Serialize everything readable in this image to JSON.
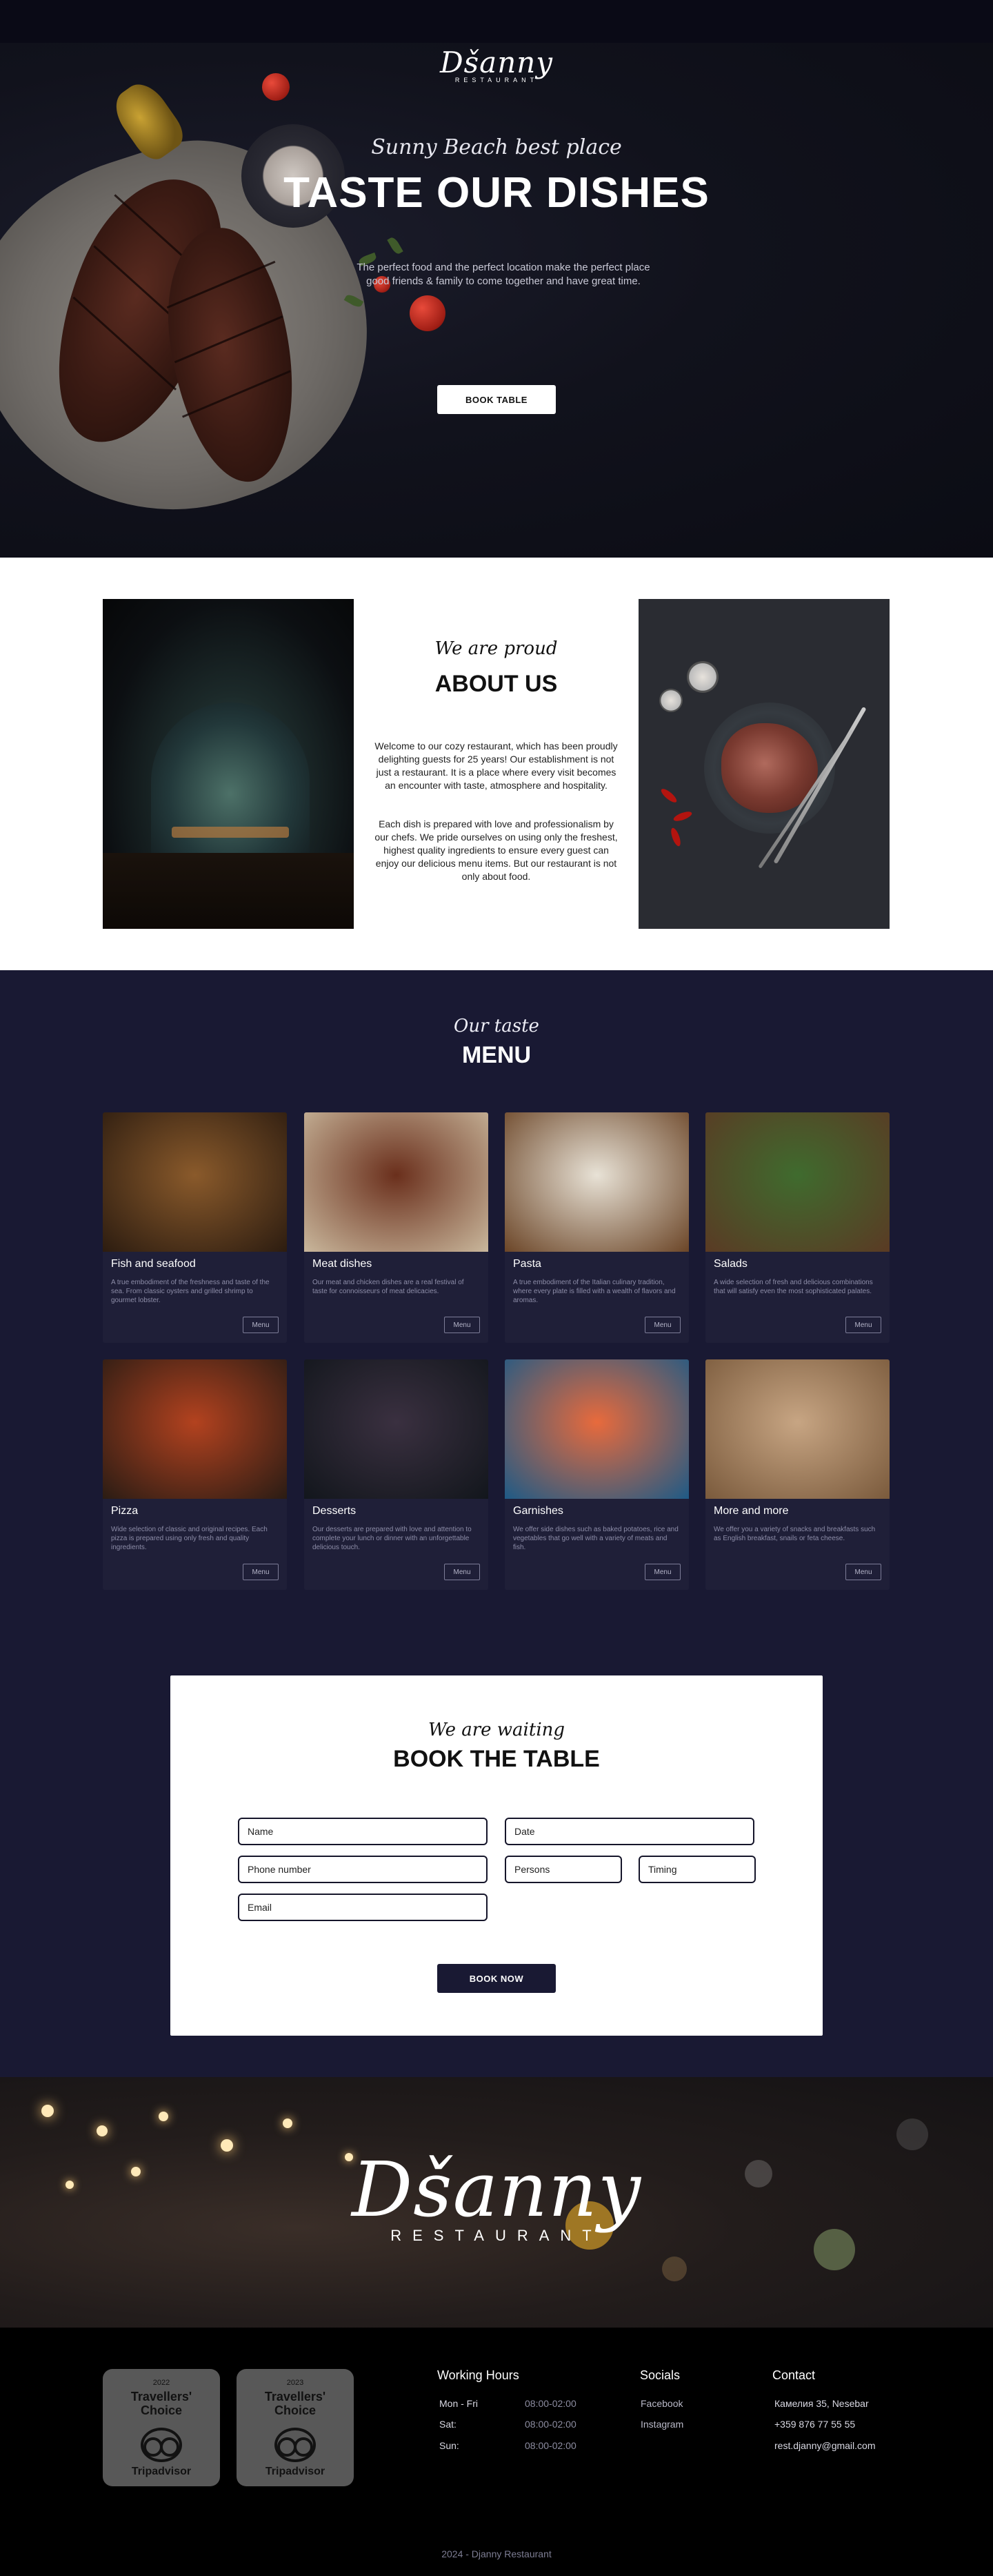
{
  "hero": {
    "logo_word": "Dšanny",
    "logo_sub": "RESTAURANT",
    "tagline": "Sunny Beach best place",
    "title": "TASTE OUR DISHES",
    "text": "The perfect food and the perfect location make the perfect place good friends & family to come together and have great time.",
    "cta_label": "BOOK TABLE"
  },
  "about": {
    "tagline": "We are proud",
    "title": "ABOUT US",
    "p1": "Welcome to our cozy restaurant, which has been proudly delighting guests for 25 years! Our establishment is not just a restaurant. It is a place where every visit becomes an encounter with taste, atmosphere and hospitality.",
    "p2": "Each dish is prepared with love and professionalism by our chefs. We pride ourselves on using only the freshest, highest quality ingredients to ensure every guest can enjoy our delicious menu items. But our restaurant is not only about food."
  },
  "menu": {
    "tagline": "Our taste",
    "title": "MENU",
    "items": [
      {
        "title": "Fish and seafood",
        "desc": "A true embodiment of the freshness and taste of the sea. From classic oysters and grilled shrimp to gourmet lobster.",
        "button": "Menu",
        "img_a": "#8a5a2b",
        "img_b": "#2c1c10"
      },
      {
        "title": "Meat dishes",
        "desc": "Our meat and chicken dishes are a real festival of taste for connoisseurs of meat delicacies.",
        "button": "Menu",
        "img_a": "#6a2f1c",
        "img_b": "#c9b79c"
      },
      {
        "title": "Pasta",
        "desc": "A true embodiment of the Italian culinary tradition, where every plate is filled with a wealth of flavors and aromas.",
        "button": "Menu",
        "img_a": "#e8e2d6",
        "img_b": "#6b4527"
      },
      {
        "title": "Salads",
        "desc": "A wide selection of fresh and delicious combinations that will satisfy even the most sophisticated palates.",
        "button": "Menu",
        "img_a": "#3f6b2e",
        "img_b": "#5a3a24"
      },
      {
        "title": "Pizza",
        "desc": "Wide selection of classic and original recipes. Each pizza is prepared using only fresh and quality ingredients.",
        "button": "Menu",
        "img_a": "#b3421f",
        "img_b": "#2a1c14"
      },
      {
        "title": "Desserts",
        "desc": "Our desserts are prepared with love and attention to complete your lunch or dinner with an unforgettable delicious touch.",
        "button": "Menu",
        "img_a": "#3a3040",
        "img_b": "#12161c"
      },
      {
        "title": "Garnishes",
        "desc": "We offer side dishes such as baked potatoes, rice and vegetables that go well with a variety of meats and fish.",
        "button": "Menu",
        "img_a": "#e86a3c",
        "img_b": "#1e5a86"
      },
      {
        "title": "More and more",
        "desc": "We offer you a variety of snacks and breakfasts such as English breakfast, snails or feta cheese.",
        "button": "Menu",
        "img_a": "#c7a583",
        "img_b": "#7a5a3c"
      }
    ]
  },
  "booking": {
    "tagline": "We are waiting",
    "title": "BOOK THE TABLE",
    "name_placeholder": "Name",
    "date_placeholder": "Date",
    "phone_placeholder": "Phone number",
    "persons_placeholder": "Persons",
    "timing_placeholder": "Timing",
    "email_placeholder": "Email",
    "submit_label": "BOOK NOW"
  },
  "banner": {
    "logo_word": "Dšanny",
    "logo_sub": "RESTAURANT"
  },
  "footer": {
    "badges": [
      {
        "year": "2022",
        "line1": "Travellers'",
        "line2": "Choice",
        "brand": "Tripadvisor",
        "icon": "tripadvisor-owl-icon"
      },
      {
        "year": "2023",
        "line1": "Travellers'",
        "line2": "Choice",
        "brand": "Tripadvisor",
        "icon": "tripadvisor-owl-icon"
      }
    ],
    "hours_title": "Working Hours",
    "hours": [
      {
        "day": "Mon - Fri",
        "time": "08:00-02:00"
      },
      {
        "day": "Sat:",
        "time": "08:00-02:00"
      },
      {
        "day": "Sun:",
        "time": "08:00-02:00"
      }
    ],
    "socials_title": "Socials",
    "socials": [
      "Facebook",
      "Instagram"
    ],
    "contact_title": "Contact",
    "contact": [
      "Камелия 35, Nesebar",
      "+359 876 77 55 55",
      "rest.djanny@gmail.com"
    ],
    "copyright": "2024 - Djanny Restaurant"
  },
  "colors": {
    "navy": "#191933",
    "white": "#ffffff",
    "black": "#000000"
  }
}
